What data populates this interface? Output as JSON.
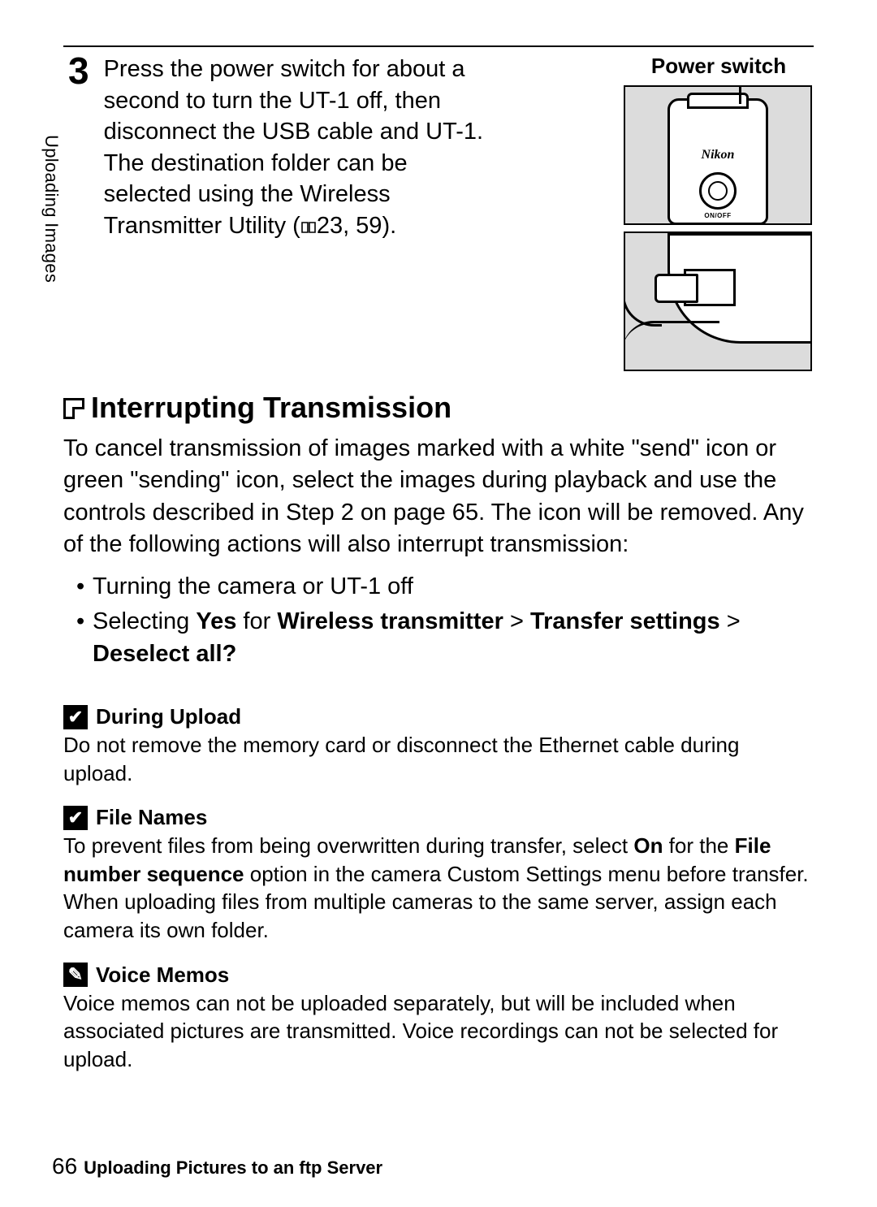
{
  "side_tab": "Uploading Images",
  "step": {
    "number": "3",
    "text_before_icon": "Press the power switch for about a second to turn the UT-1 off, then disconnect the USB cable and UT-1.  The destination folder can be selected using the Wireless Transmitter Utility (",
    "refs": "23, 59",
    "text_after": ")."
  },
  "figure": {
    "caption": "Power switch",
    "brand": "Nikon",
    "onoff": "ON/OFF"
  },
  "section": {
    "title": "Interrupting Transmission",
    "body": "To cancel transmission of images marked with a white \"send\" icon or green \"sending\" icon, select the images during playback and use the controls described in Step 2 on page 65.  The icon will be removed.  Any of the following actions will also interrupt transmission:"
  },
  "bullets": {
    "b1": "Turning the camera or UT-1 off",
    "b2_pre": "Selecting ",
    "b2_yes": "Yes",
    "b2_for": " for ",
    "b2_path1": "Wireless transmitter",
    "b2_gt1": " > ",
    "b2_path2": "Transfer settings",
    "b2_gt2": " > ",
    "b2_path3": "Deselect all?"
  },
  "notes": {
    "n1": {
      "title": "During Upload",
      "body": "Do not remove the memory card or disconnect the Ethernet cable during upload."
    },
    "n2": {
      "title": "File Names",
      "pre": "To prevent files from being overwritten during transfer, select ",
      "on": "On",
      "mid": " for the ",
      "fns": "File number sequence",
      "post": " option in the camera Custom Settings menu before transfer.  When uploading files from multiple cameras to the same server, assign each camera its own folder."
    },
    "n3": {
      "title": "Voice Memos",
      "body": "Voice memos can not be uploaded separately, but will be included when associated pictures are transmitted.  Voice recordings can not be selected for upload."
    }
  },
  "footer": {
    "page": "66",
    "title": "Uploading Pictures to an ftp Server"
  }
}
